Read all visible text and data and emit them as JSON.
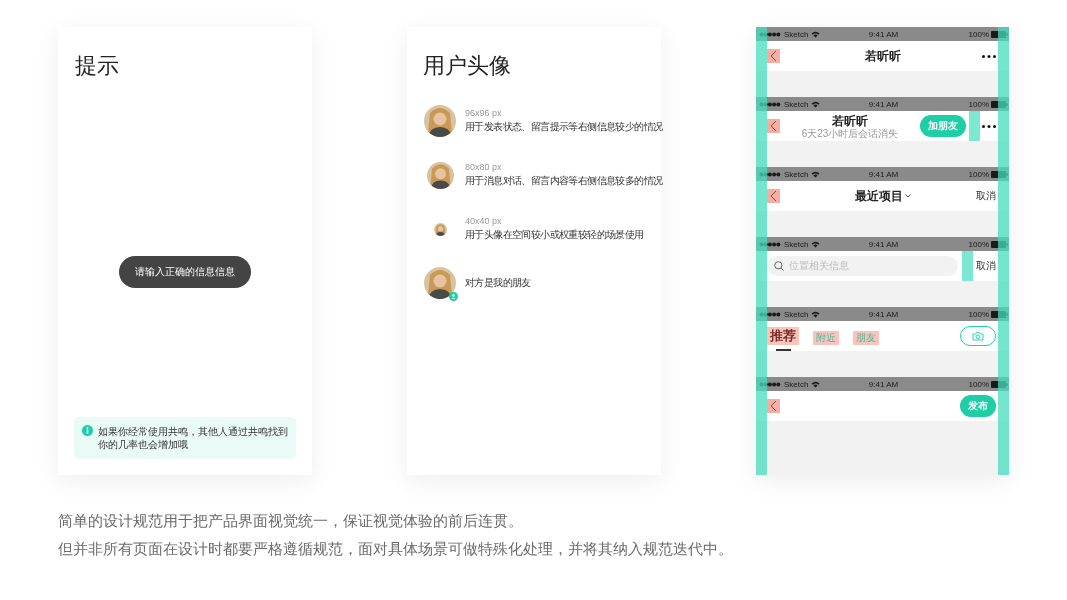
{
  "tip_card": {
    "title": "提示",
    "toast": "请输入正确的信息信息",
    "notice": "如果你经常使用共鸣，其他人通过共鸣找到你的几率也会增加哦"
  },
  "avatar_card": {
    "title": "用户头像",
    "items": [
      {
        "kind": "large",
        "size": "96x96 px",
        "description": "用于发表状态、留言提示等右侧信息较少的情况",
        "friend": false
      },
      {
        "kind": "medium",
        "size": "80x80 px",
        "description": "用于消息对话、留言内容等右侧信息较多的情况",
        "friend": false
      },
      {
        "kind": "small",
        "size": "40x40 px",
        "description": "用于头像在空间较小或权重较轻的场景使用",
        "friend": false
      },
      {
        "kind": "large",
        "description": "对方是我的朋友",
        "friend": true
      }
    ]
  },
  "nav_bars": [
    {
      "kind": "title",
      "status": {
        "carrier": "Sketch",
        "time": "9:41 AM",
        "battery": "100%"
      },
      "title": "若昕昕"
    },
    {
      "kind": "title-subtitle",
      "status": {
        "carrier": "Sketch",
        "time": "9:41 AM",
        "battery": "100%"
      },
      "title": "若昕昕",
      "subtitle": "6天23小时后会话消失",
      "button": "加朋友"
    },
    {
      "kind": "dropdown",
      "status": {
        "carrier": "Sketch",
        "time": "9:41 AM",
        "battery": "100%"
      },
      "title": "最近项目",
      "action": "取消"
    },
    {
      "kind": "search",
      "status": {
        "carrier": "Sketch",
        "time": "9:41 AM",
        "battery": "100%"
      },
      "placeholder": "位置相关信息",
      "action": "取消"
    },
    {
      "kind": "tabs",
      "status": {
        "carrier": "Sketch",
        "time": "9:41 AM",
        "battery": "100%"
      },
      "tabs": [
        {
          "label": "推荐",
          "selected": true
        },
        {
          "label": "附近",
          "selected": false
        },
        {
          "label": "朋友",
          "selected": false
        }
      ]
    },
    {
      "kind": "publish",
      "status": {
        "carrier": "Sketch",
        "time": "9:41 AM",
        "battery": "100%"
      },
      "button": "发布"
    }
  ],
  "notes": [
    "简单的设计规范用于把产品界面视觉统一，保证视觉体验的前后连贯。",
    "但并非所有页面在设计时都要严格遵循规范，面对具体场景可做特殊化处理，并将其纳入规范迭代中。"
  ]
}
